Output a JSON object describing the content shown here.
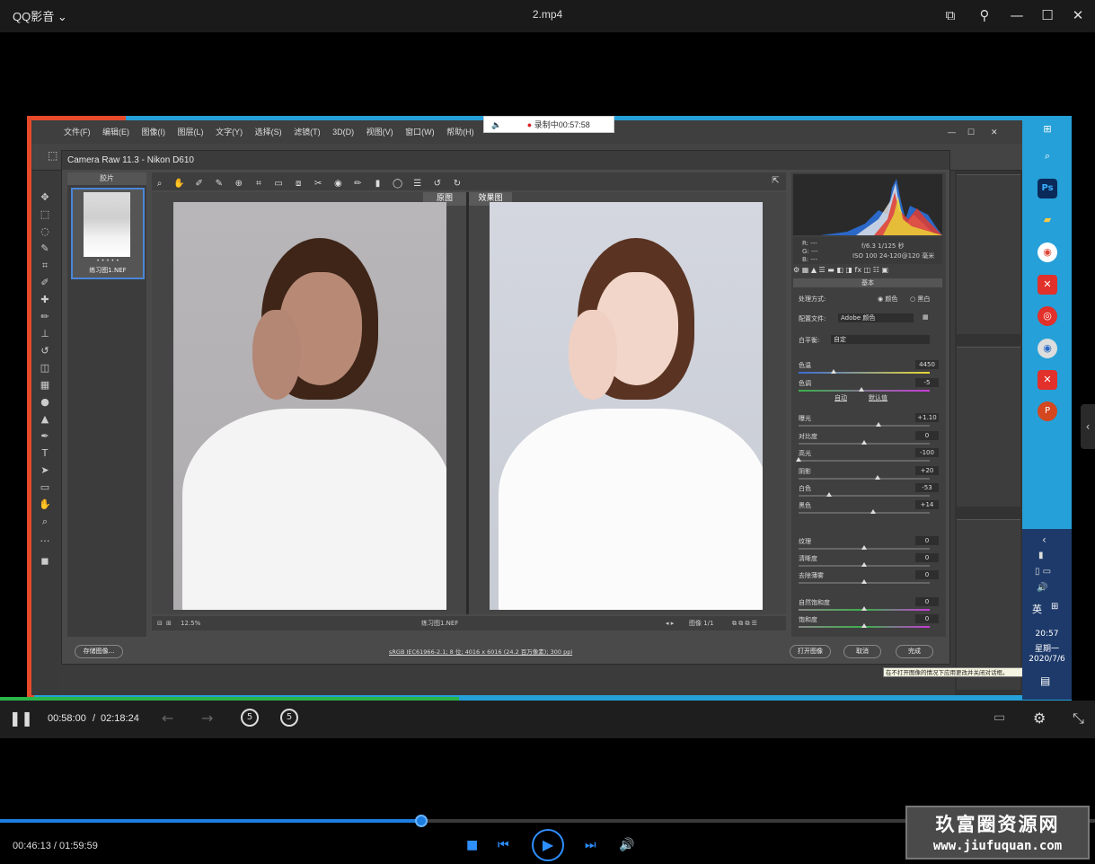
{
  "player": {
    "app_name": "QQ影音",
    "file_title": "2.mp4",
    "current_time": "00:58:00",
    "time_separator": "/",
    "total_time": "02:18:24",
    "progress": 0.419,
    "bottom_time": "00:46:13 / 01:59:59",
    "bottom_progress": 0.385,
    "accent": "#1d7ee0"
  },
  "recording": {
    "label": "录制中00:57:58"
  },
  "photoshop": {
    "menu": [
      "文件(F)",
      "编辑(E)",
      "图像(I)",
      "图层(L)",
      "文字(Y)",
      "选择(S)",
      "滤镜(T)",
      "3D(D)",
      "视图(V)",
      "窗口(W)",
      "帮助(H)"
    ]
  },
  "camera_raw": {
    "title": "Camera Raw 11.3 -  Nikon D610",
    "filmstrip_label": "胶片",
    "thumb_name": "练习图1.NEF",
    "thumb_rating": "• • • • •",
    "label_before": "原图",
    "label_after": "效果图",
    "zoom": "12.5%",
    "file_name": "练习图1.NEF",
    "image_count": "图像 1/1",
    "exif_line1": "f/6.3   1/125 秒",
    "exif_line2": "ISO 100   24-120@120 毫米",
    "rgb_r": "R:  ---",
    "rgb_g": "G:  ---",
    "rgb_b": "B:  ---",
    "panel_title": "基本",
    "treatment_label": "处理方式:",
    "treatment_color": "颜色",
    "treatment_bw": "黑白",
    "profile_label": "配置文件:",
    "profile_value": "Adobe 颜色",
    "wb_label": "白平衡:",
    "wb_value": "自定",
    "auto_label": "自动",
    "default_label": "默认值",
    "sliders": [
      {
        "name": "色温",
        "value": "4450",
        "pos": 0.27
      },
      {
        "name": "色调",
        "value": "-5",
        "pos": 0.48
      },
      {
        "name": "曝光",
        "value": "+1.10",
        "pos": 0.61
      },
      {
        "name": "对比度",
        "value": "0",
        "pos": 0.5
      },
      {
        "name": "高光",
        "value": "-100",
        "pos": 0.0
      },
      {
        "name": "阴影",
        "value": "+20",
        "pos": 0.6
      },
      {
        "name": "白色",
        "value": "-53",
        "pos": 0.23
      },
      {
        "name": "黑色",
        "value": "+14",
        "pos": 0.57
      },
      {
        "name": "纹理",
        "value": "0",
        "pos": 0.5
      },
      {
        "name": "清晰度",
        "value": "0",
        "pos": 0.5
      },
      {
        "name": "去除薄雾",
        "value": "0",
        "pos": 0.5
      },
      {
        "name": "自然饱和度",
        "value": "0",
        "pos": 0.5
      },
      {
        "name": "饱和度",
        "value": "0",
        "pos": 0.5
      }
    ],
    "save_button": "存储图像...",
    "workflow_link": "sRGB IEC61966-2.1; 8 位; 4016 x 6016 (24.2 百万像素); 300 ppi",
    "open_button": "打开图像",
    "cancel_button": "取消",
    "done_button": "完成",
    "tooltip": "在不打开图像的情况下应用更改并关闭对话框。"
  },
  "taskbar": {
    "ime": "英",
    "clock_time": "20:57",
    "clock_day": "星期一",
    "clock_date": "2020/7/6"
  },
  "watermark": {
    "line1": "玖富圈资源网",
    "line2": "www.jiufuquan.com"
  }
}
